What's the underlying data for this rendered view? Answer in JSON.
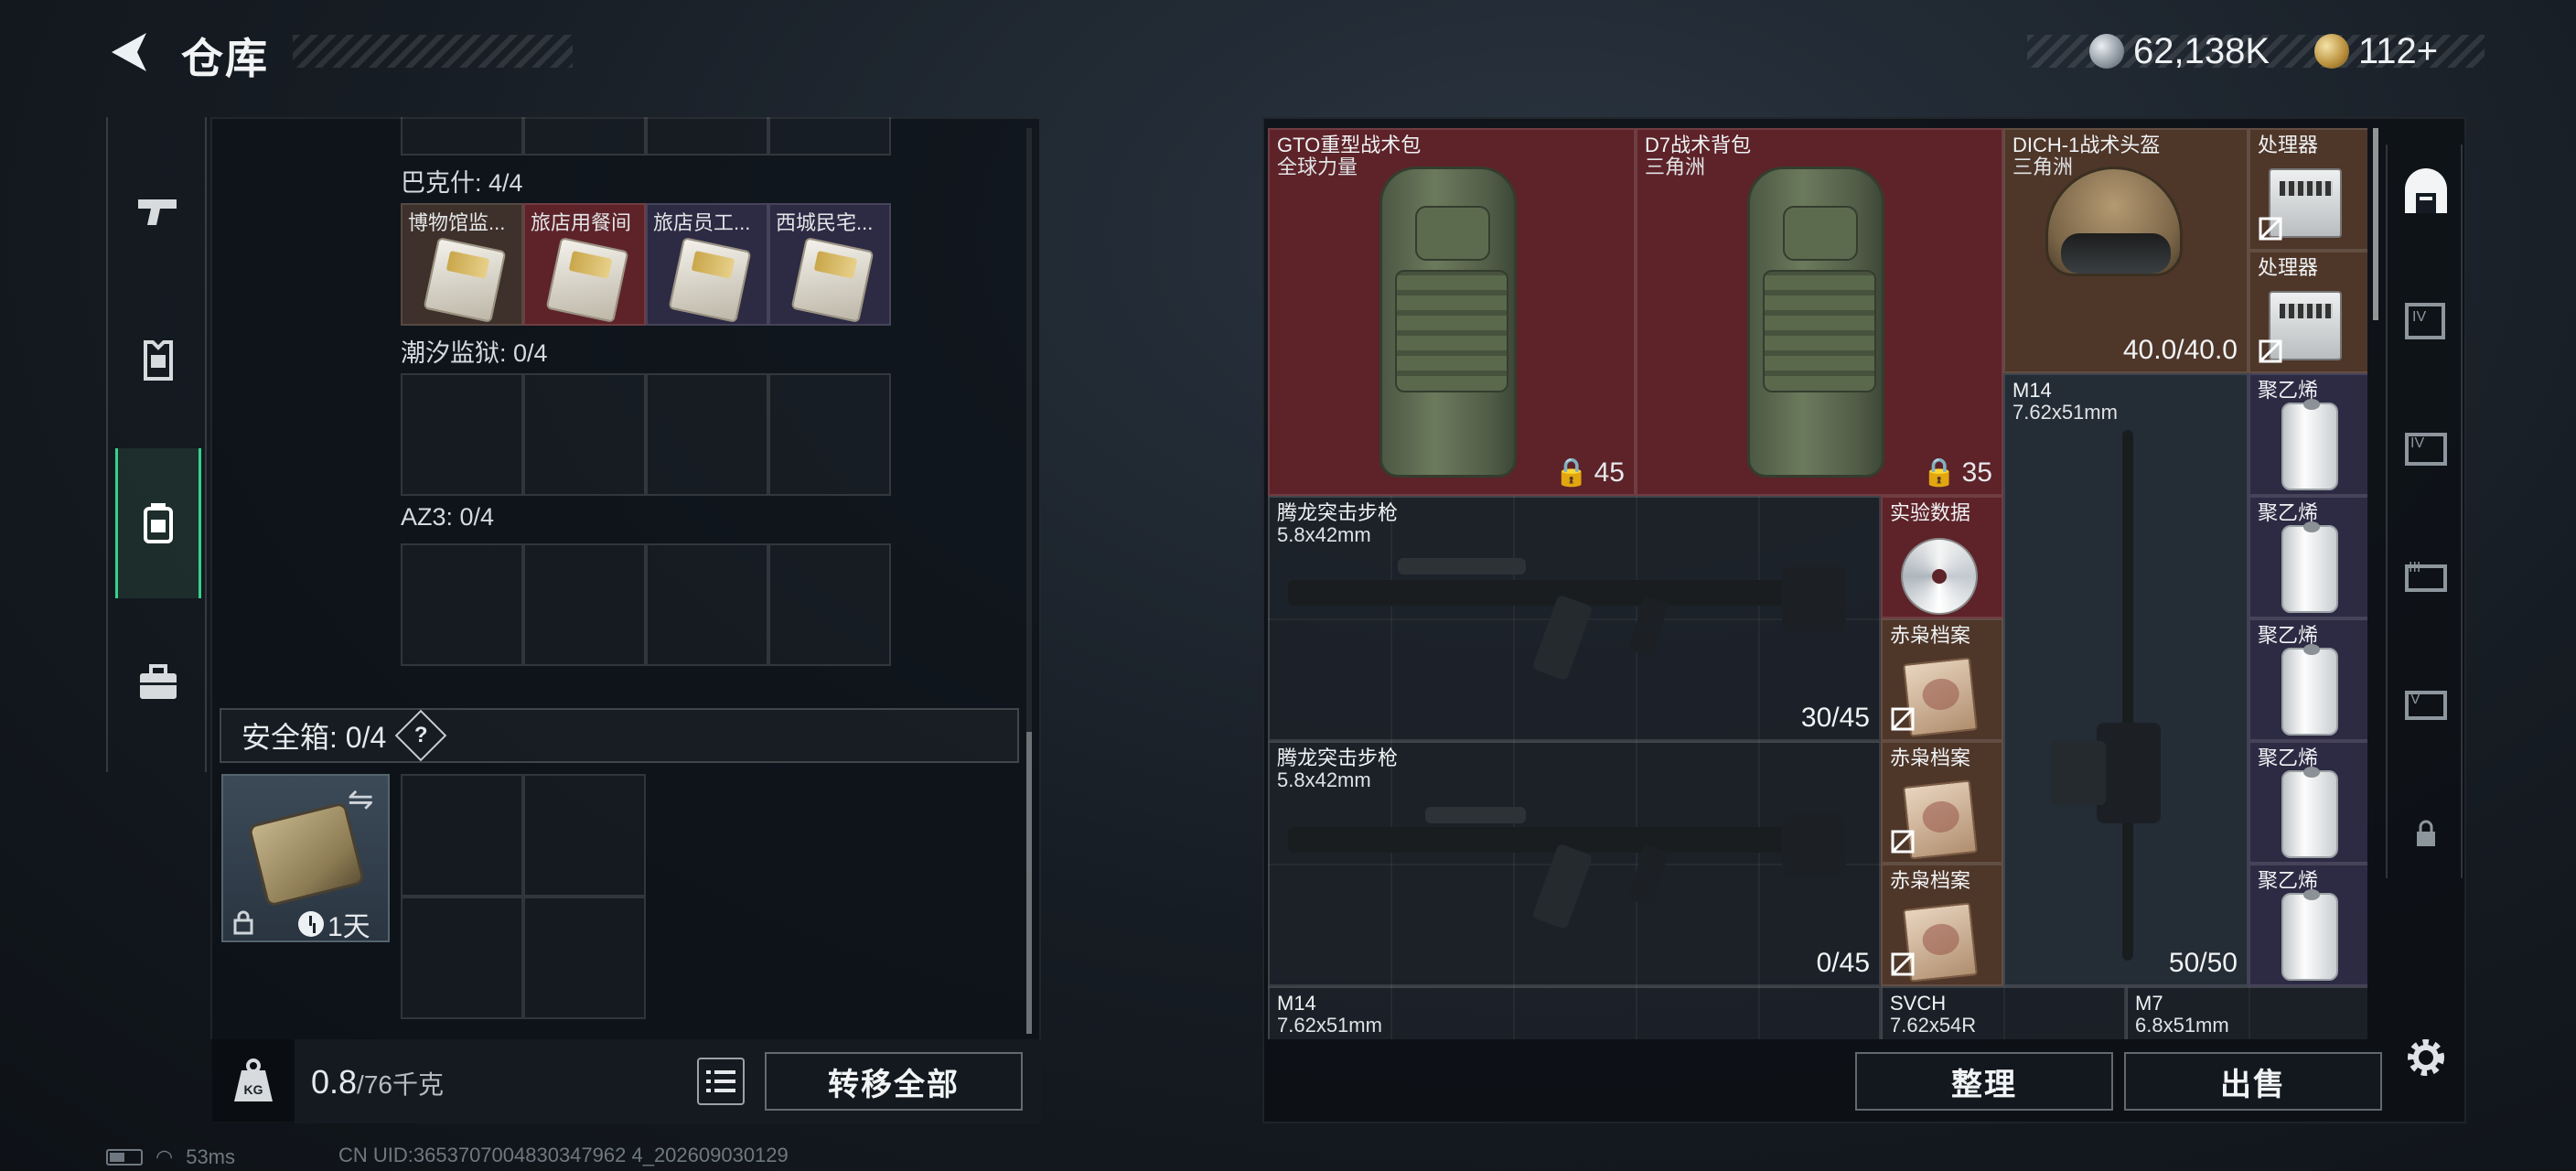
{
  "header": {
    "title": "仓库",
    "currency_a": "62,138K",
    "currency_b": "112+"
  },
  "left_rail": {
    "items": [
      {
        "name": "weapons",
        "icon": "pistol-icon"
      },
      {
        "name": "armor",
        "icon": "armor-icon"
      },
      {
        "name": "backpack",
        "icon": "backpack-icon",
        "selected": true
      },
      {
        "name": "case",
        "icon": "toolbox-icon"
      }
    ]
  },
  "containers": {
    "bakeshen": {
      "label": "巴克什: 4/4",
      "slots": [
        "博物馆监...",
        "旅店用餐间",
        "旅店员工...",
        "西城民宅..."
      ]
    },
    "chaoxi": {
      "label": "潮汐监狱: 0/4"
    },
    "az3": {
      "label": "AZ3: 0/4"
    }
  },
  "safe_box": {
    "label": "安全箱: 0/4",
    "help": "?",
    "timer": "1天"
  },
  "left_bottom": {
    "weight_current": "0.8",
    "weight_max": "/76千克",
    "transfer_all": "转移全部"
  },
  "stash_items": [
    {
      "title": "GTO重型战术包",
      "sub": "全球力量",
      "capacity": "45"
    },
    {
      "title": "D7战术背包",
      "sub": "三角洲",
      "capacity": "35"
    },
    {
      "title": "DICH-1战术头盔",
      "sub": "三角洲",
      "count": "40.0/40.0"
    },
    {
      "title": "处理器"
    },
    {
      "title": "处理器"
    },
    {
      "title": "M14",
      "sub": "7.62x51mm",
      "count": "50/50"
    },
    {
      "title": "聚乙烯"
    },
    {
      "title": "聚乙烯"
    },
    {
      "title": "聚乙烯"
    },
    {
      "title": "聚乙烯"
    },
    {
      "title": "聚乙烯"
    },
    {
      "title": "腾龙突击步枪",
      "sub": "5.8x42mm",
      "count": "30/45"
    },
    {
      "title": "实验数据"
    },
    {
      "title": "赤枭档案"
    },
    {
      "title": "腾龙突击步枪",
      "sub": "5.8x42mm",
      "count": "0/45"
    },
    {
      "title": "赤枭档案"
    },
    {
      "title": "赤枭档案"
    },
    {
      "title": "M14",
      "sub": "7.62x51mm"
    },
    {
      "title": "SVCH",
      "sub": "7.62x54R"
    },
    {
      "title": "M7",
      "sub": "6.8x51mm"
    }
  ],
  "right_bottom": {
    "sort": "整理",
    "sell": "出售"
  },
  "status": {
    "ping": "53ms",
    "uid": "CN UID:3653707004830347962 4_202609030129"
  },
  "colors": {
    "accent_green": "#33d38a",
    "rarity_red": "#5d2329",
    "rarity_purple": "#2d2a44"
  }
}
